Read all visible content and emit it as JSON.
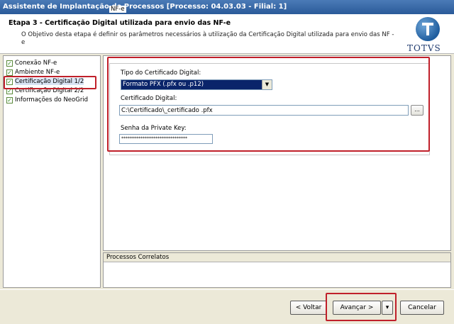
{
  "window": {
    "title": "Assistente de Implantação de Processos [Processo: 04.03.03 - Filial: 1]"
  },
  "header": {
    "step_title": "Etapa 3 - Certificação Digital utilizada para envio das NF-e",
    "step_description": "O Objetivo desta etapa é definir os parâmetros necessários à utilização da Certificação Digital utilizada para envio das NF -e",
    "logo_text": "TOTVS"
  },
  "nav": {
    "items": [
      {
        "label": "Conexão NF-e",
        "checked": true
      },
      {
        "label": "Ambiente NF-e",
        "checked": true
      },
      {
        "label": "Certificação Digital 1/2",
        "checked": true,
        "active": true
      },
      {
        "label": "Certificação Digital 2/2",
        "checked": true
      },
      {
        "label": "Informações do NeoGrid",
        "checked": true
      }
    ]
  },
  "form": {
    "group_label": "NF-e",
    "cert_type_label": "Tipo do Certificado Digital:",
    "cert_type_value": "Formato PFX (.pfx ou .p12)",
    "cert_label": "Certificado Digital:",
    "cert_value": "C:\\Certificado\\_certificado .pfx",
    "browse_label": "...",
    "key_label": "Senha da Private Key:",
    "key_value": "*******************************"
  },
  "correlatos": {
    "header": "Processos Correlatos"
  },
  "footer": {
    "back_label": "< Voltar",
    "next_label": "Avançar >",
    "dropdown_label": "▾",
    "cancel_label": "Cancelar"
  },
  "colors": {
    "highlight_red": "#c0202a",
    "selection_blue": "#0a246a",
    "titlebar_blue": "#2a5a99"
  },
  "icons": {
    "checkbox": "check-icon",
    "dropdown": "dropdown-arrow-icon"
  }
}
